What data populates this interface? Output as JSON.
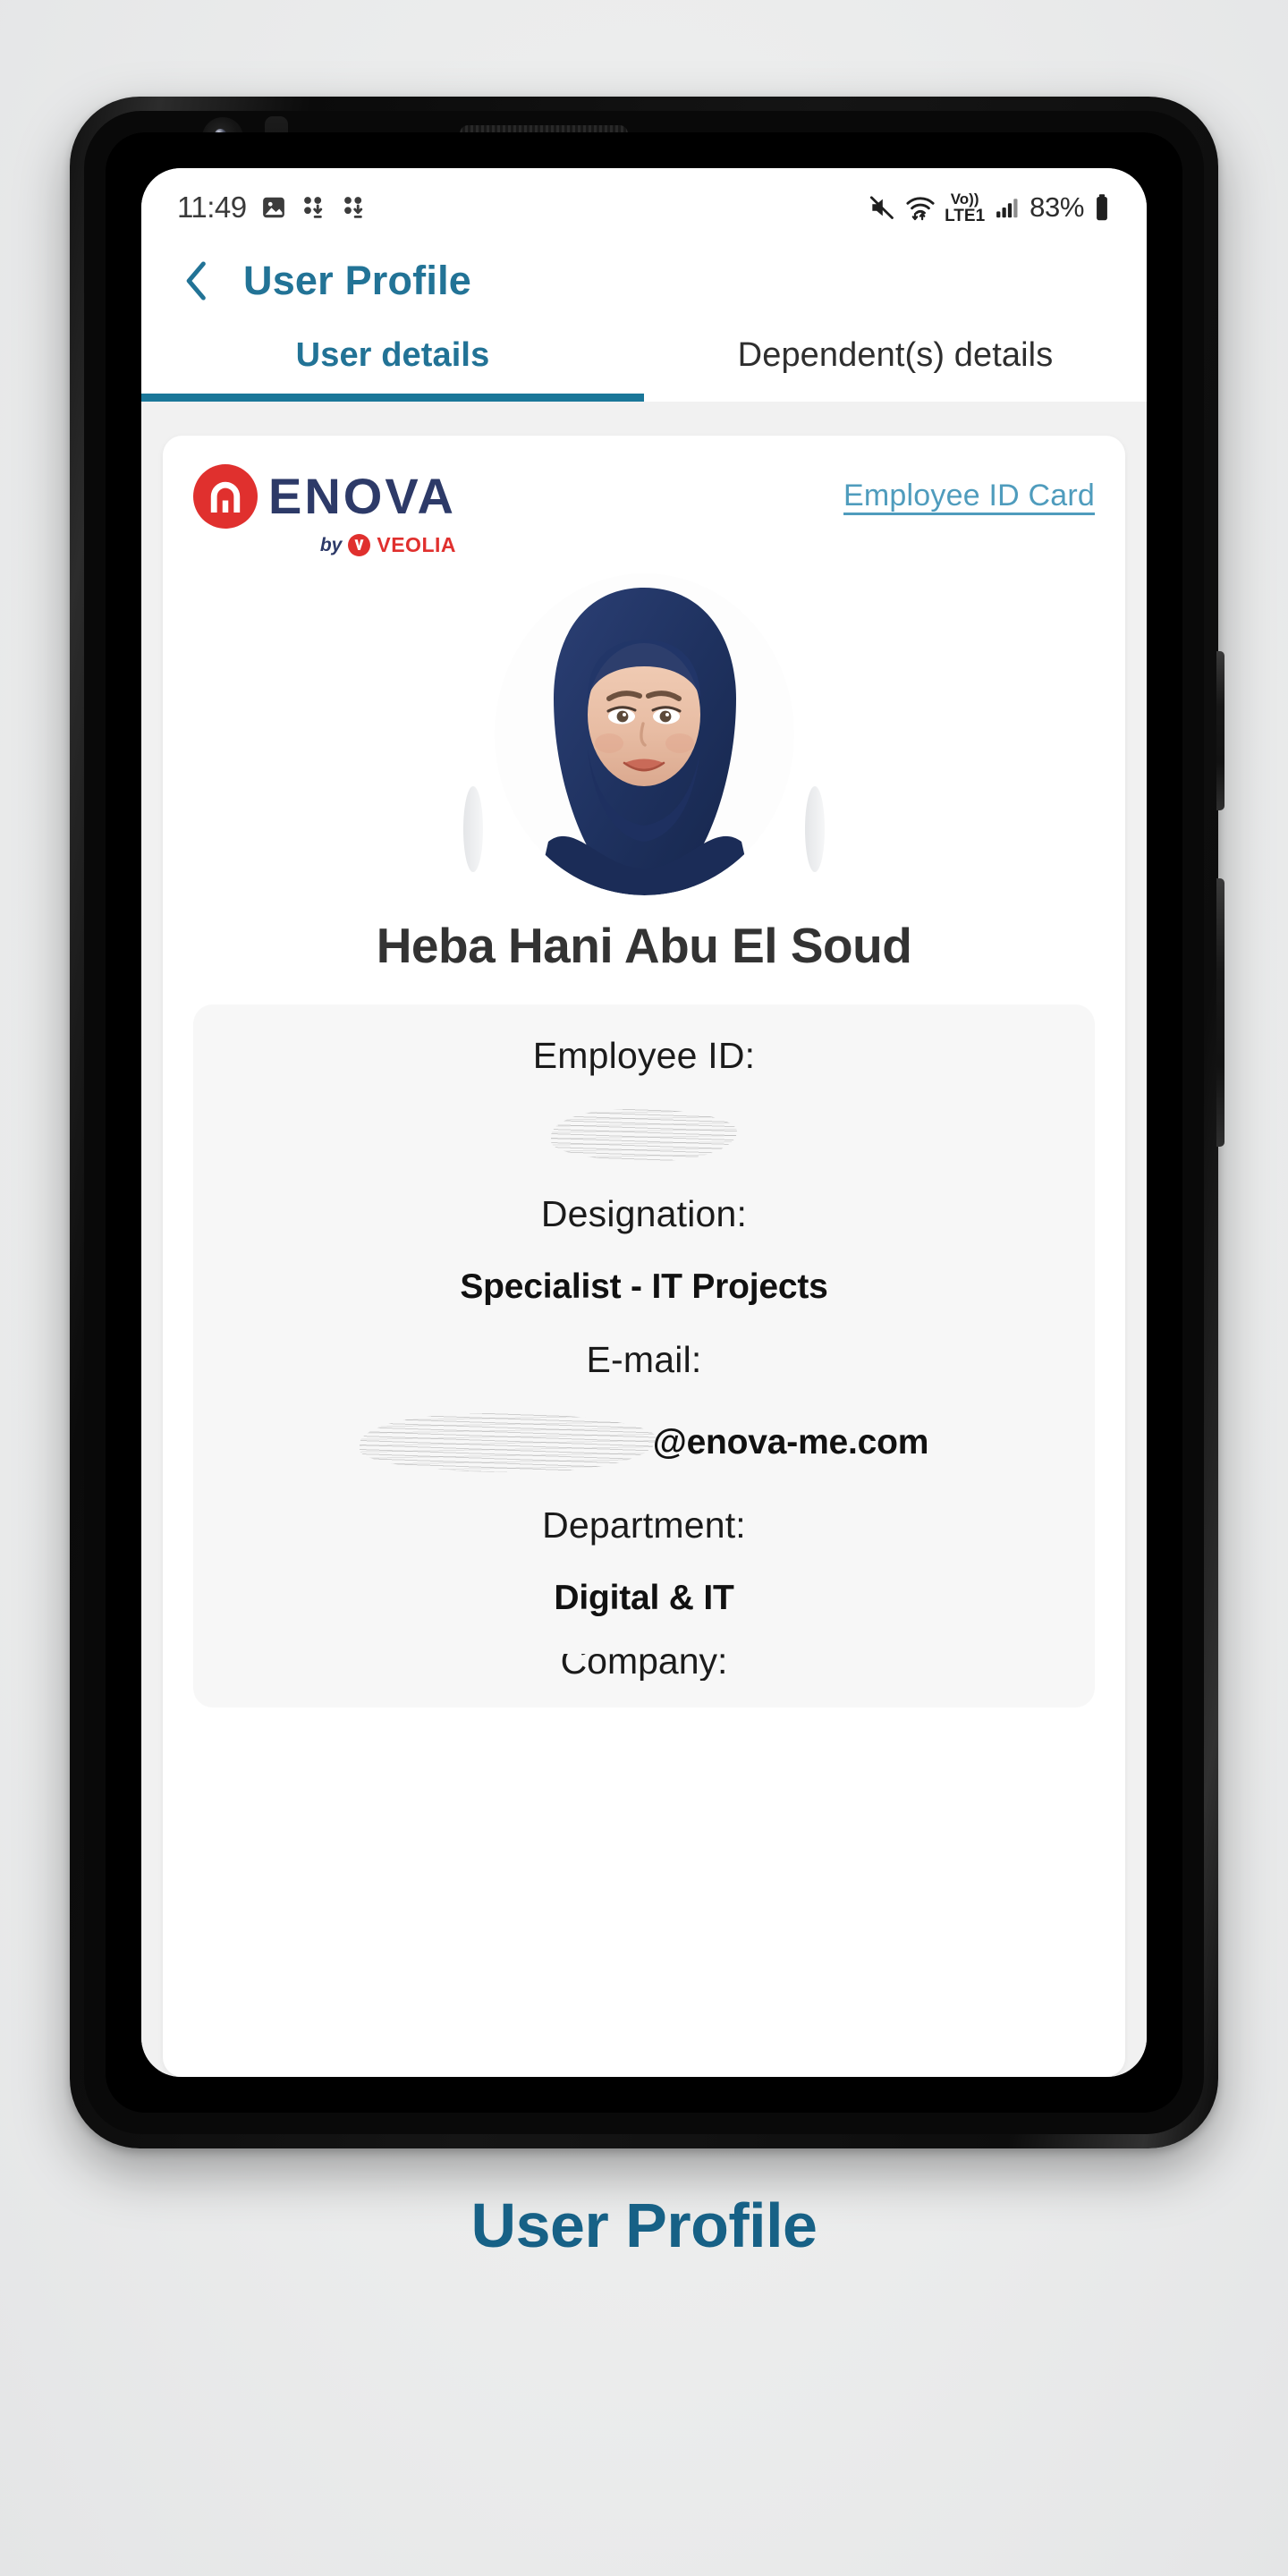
{
  "status_bar": {
    "time": "11:49",
    "battery_percent": "83%",
    "left_icons": [
      "image-icon",
      "download-icon",
      "download-icon"
    ],
    "right_icons": [
      "mute-icon",
      "wifi-icon",
      "volte1-icon",
      "signal-icon",
      "battery-icon"
    ],
    "volte_label": "Vo))",
    "lte_label": "LTE1"
  },
  "header": {
    "back_icon": "chevron-left-icon",
    "title": "User Profile"
  },
  "tabs": [
    {
      "label": "User details",
      "active": true
    },
    {
      "label": "Dependent(s) details",
      "active": false
    }
  ],
  "card": {
    "logo": {
      "wordmark": "ENOVA",
      "by_text": "by",
      "parent_brand": "VEOLIA"
    },
    "id_card_link": "Employee ID Card",
    "photo_alt": "employee-photo",
    "employee_name": "Heba Hani Abu El Soud",
    "details": [
      {
        "label": "Employee ID:",
        "value": "",
        "redacted": true,
        "redaction": "full"
      },
      {
        "label": "Designation:",
        "value": "Specialist - IT Projects",
        "redacted": false,
        "redaction": "none"
      },
      {
        "label": "E-mail:",
        "value": "@enova-me.com",
        "redacted": true,
        "redaction": "partial"
      },
      {
        "label": "Department:",
        "value": "Digital & IT",
        "redacted": false,
        "redaction": "none"
      }
    ],
    "cut_off_label": "Company:"
  },
  "bottom_caption": "User Profile",
  "colors": {
    "accent_teal": "#227396",
    "tab_underline": "#1a7799",
    "link_blue": "#4f9cbd",
    "caption_teal": "#176186",
    "brand_red": "#e0302e",
    "brand_navy": "#2d3a68",
    "page_bg": "#f1f1f1",
    "card_bg": "#ffffff",
    "panel_bg": "#f7f7f7"
  }
}
